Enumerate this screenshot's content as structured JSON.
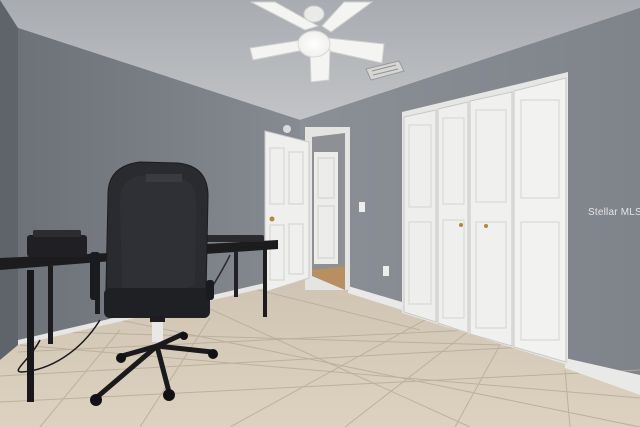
{
  "photo": {
    "subject": "bedroom-office",
    "watermark_text": "Stellar MLS",
    "chair_logo_text": "",
    "colors": {
      "wall": "#8a8e95",
      "ceiling": "#b7b9bd",
      "floor_tile": "#d8cdbb",
      "door": "#eeeeee",
      "chair": "#2a2b2f"
    }
  }
}
